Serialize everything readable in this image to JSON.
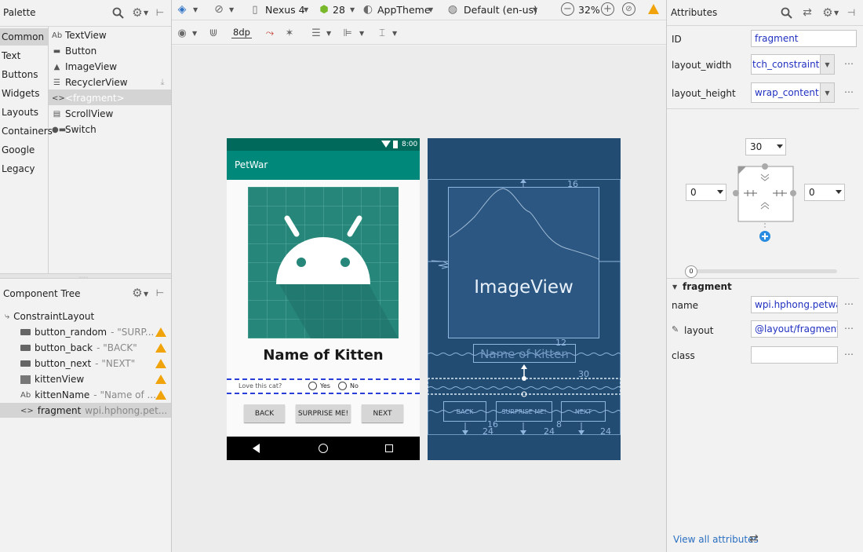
{
  "palette": {
    "title": "Palette",
    "categories": [
      "Common",
      "Text",
      "Buttons",
      "Widgets",
      "Layouts",
      "Containers",
      "Google",
      "Legacy"
    ],
    "items": [
      {
        "icon": "Ab",
        "label": "TextView"
      },
      {
        "icon": "▬",
        "label": "Button"
      },
      {
        "icon": "▲",
        "label": "ImageView"
      },
      {
        "icon": "☰",
        "label": "RecyclerView"
      },
      {
        "icon": "<>",
        "label": "<fragment>"
      },
      {
        "icon": "▤",
        "label": "ScrollView"
      },
      {
        "icon": "●▬",
        "label": "Switch"
      }
    ]
  },
  "component_tree": {
    "title": "Component Tree",
    "root": "ConstraintLayout",
    "nodes": [
      {
        "icon": "button",
        "name": "button_random",
        "sub": "- \"SURP...",
        "warning": true
      },
      {
        "icon": "button",
        "name": "button_back",
        "sub": "- \"BACK\"",
        "warning": true
      },
      {
        "icon": "button",
        "name": "button_next",
        "sub": "- \"NEXT\"",
        "warning": true
      },
      {
        "icon": "image",
        "name": "kittenView",
        "sub": "",
        "warning": true
      },
      {
        "icon": "text",
        "name": "kittenName",
        "sub": "- \"Name of ...",
        "warning": true
      },
      {
        "icon": "fragment",
        "name": "fragment",
        "sub": "wpi.hphong.pet...",
        "warning": false
      }
    ]
  },
  "toolbar": {
    "device": "Nexus 4",
    "api": "28",
    "theme": "AppTheme",
    "locale": "Default (en-us)",
    "zoom": "32%",
    "margin": "8dp"
  },
  "phone": {
    "time": "8:00",
    "app_title": "PetWar",
    "kitten_name": "Name of Kitten",
    "question": "Love this cat?",
    "yes": "Yes",
    "no": "No",
    "buttons": [
      "BACK",
      "SURPRISE ME!",
      "NEXT"
    ]
  },
  "blueprint": {
    "image_label": "ImageView",
    "name_label": "Name of Kitten",
    "buttons": [
      "BACK",
      "SURPRISE ME!",
      "NEXT"
    ],
    "numbers": {
      "top": "16",
      "mid": "12",
      "right": "30",
      "b1": "16",
      "b2": "8",
      "d1": "24",
      "d2": "24",
      "d3": "24"
    }
  },
  "attributes": {
    "title": "Attributes",
    "id_label": "ID",
    "id_value": "fragment",
    "width_label": "layout_width",
    "width_value": "match_constraint",
    "height_label": "layout_height",
    "height_value": "wrap_content",
    "constraint_top": "30",
    "constraint_left": "0",
    "constraint_right": "0",
    "bias_value": "0",
    "section": "fragment",
    "name_label": "name",
    "name_value": "wpi.hphong.petwar",
    "layout_label": "layout",
    "layout_value": "@layout/fragment_",
    "class_label": "class",
    "class_value": "",
    "view_all": "View all attributes"
  },
  "colors": {
    "teal_dark": "#00695c",
    "teal": "#00897b",
    "blueprint_bg": "#234c72",
    "blueprint_line": "#8fb6de",
    "selection": "#2a3fd8",
    "warning": "#f0a30a",
    "link": "#2a6fc1"
  }
}
